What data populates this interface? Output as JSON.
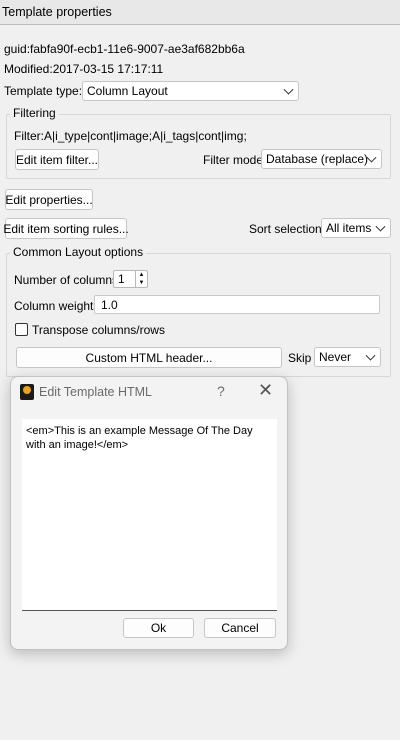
{
  "window": {
    "title": "Template properties"
  },
  "info": {
    "guid": "guid:fabfa90f-ecb1-11e6-9007-ae3af682bb6a",
    "modified": "Modified:2017-03-15 17:17:11"
  },
  "template_type": {
    "label": "Template type:",
    "value": "Column Layout"
  },
  "filtering": {
    "title": "Filtering",
    "filter_text": "Filter:A|i_type|cont|image;A|i_tags|cont|img;",
    "edit_filter_label": "Edit item filter...",
    "mode_label": "Filter mode",
    "mode_value": "Database (replace)"
  },
  "edit_properties_label": "Edit properties...",
  "sorting": {
    "edit_rules_label": "Edit item sorting rules...",
    "selection_label": "Sort selection",
    "selection_value": "All items"
  },
  "layout": {
    "title": "Common Layout options",
    "columns_label": "Number of columns",
    "columns_value": "1",
    "weights_label": "Column weights",
    "weights_value": "1.0",
    "transpose_label": "Transpose columns/rows",
    "custom_header_label": "Custom HTML header...",
    "skip_label": "Skip",
    "skip_value": "Never"
  },
  "dialog": {
    "title": "Edit Template HTML",
    "help": "?",
    "close": "✕",
    "content": "<em>This is an example Message Of The Day with an image!</em>",
    "ok_label": "Ok",
    "cancel_label": "Cancel"
  }
}
